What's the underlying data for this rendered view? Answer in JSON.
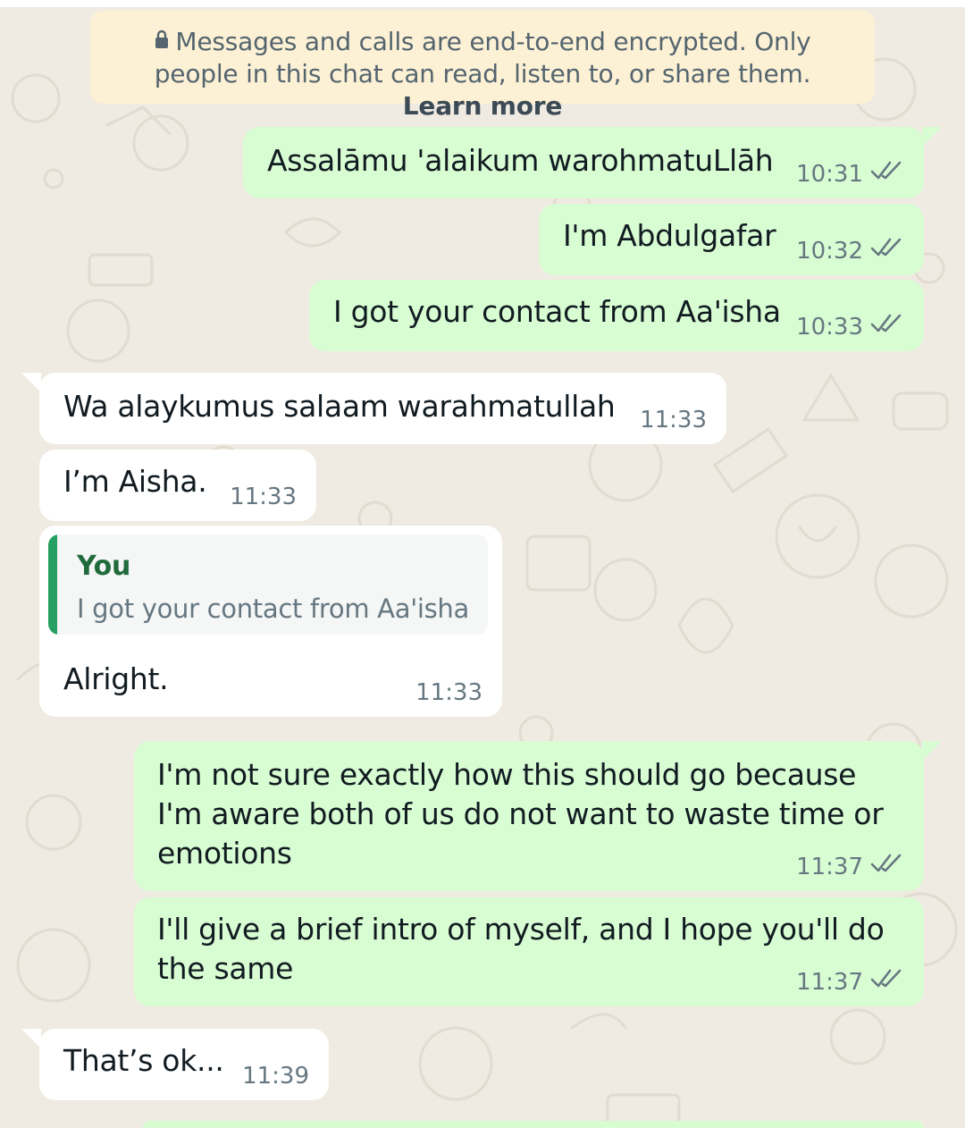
{
  "encryption_notice": {
    "text": "Messages and calls are end-to-end encrypted. Only people in this chat can read, listen to, or share them.",
    "link": "Learn more"
  },
  "messages": [
    {
      "direction": "out",
      "text": "Assalāmu 'alaikum warohmatuLlāh",
      "time": "10:31",
      "status": "read"
    },
    {
      "direction": "out",
      "text": "I'm Abdulgafar",
      "time": "10:32",
      "status": "read"
    },
    {
      "direction": "out",
      "text": "I got your contact from Aa'isha",
      "time": "10:33",
      "status": "read"
    },
    {
      "direction": "in",
      "text": "Wa alaykumus salaam warahmatullah",
      "time": "11:33"
    },
    {
      "direction": "in",
      "text": "I’m Aisha.",
      "time": "11:33"
    },
    {
      "direction": "in",
      "text": "Alright.",
      "time": "11:33",
      "quote": {
        "author": "You",
        "text": "I got your contact from Aa'isha"
      }
    },
    {
      "direction": "out",
      "text": "I'm not sure exactly how this should go because I'm aware both of us do not want to waste time or emotions",
      "time": "11:37",
      "status": "read"
    },
    {
      "direction": "out",
      "text": "I'll give a brief intro of myself, and I hope you'll do the same",
      "time": "11:37",
      "status": "read"
    },
    {
      "direction": "in",
      "text": "That’s ok...",
      "time": "11:39"
    }
  ],
  "colors": {
    "background": "#efeae2",
    "outgoing_bubble": "#d9fdd3",
    "incoming_bubble": "#ffffff",
    "read_ticks": "#667781",
    "quote_bar": "#25a062",
    "banner": "#fdf1d5"
  }
}
